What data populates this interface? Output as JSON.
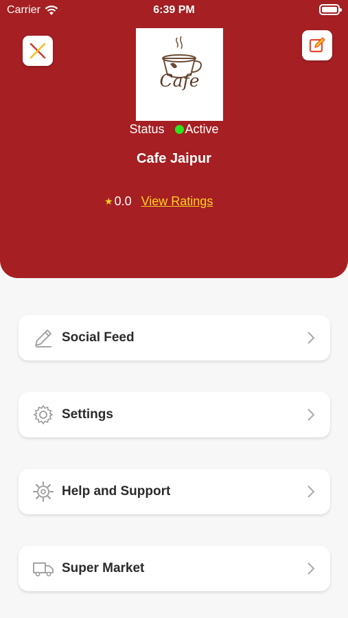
{
  "status_bar": {
    "carrier": "Carrier",
    "time": "6:39 PM"
  },
  "header": {
    "background_color": "#a51f23",
    "logo_text": "Cafe",
    "status_label": "Status",
    "status_value": "Active",
    "status_color": "#2ee31f",
    "shop_name": "Cafe Jaipur",
    "rating_value": "0.0",
    "view_ratings_label": "View Ratings"
  },
  "menu": {
    "items": [
      {
        "label": "Social Feed",
        "icon": "pencil-icon"
      },
      {
        "label": "Settings",
        "icon": "gear-icon"
      },
      {
        "label": "Help and Support",
        "icon": "help-gear-icon"
      },
      {
        "label": "Super Market",
        "icon": "truck-icon"
      }
    ]
  }
}
